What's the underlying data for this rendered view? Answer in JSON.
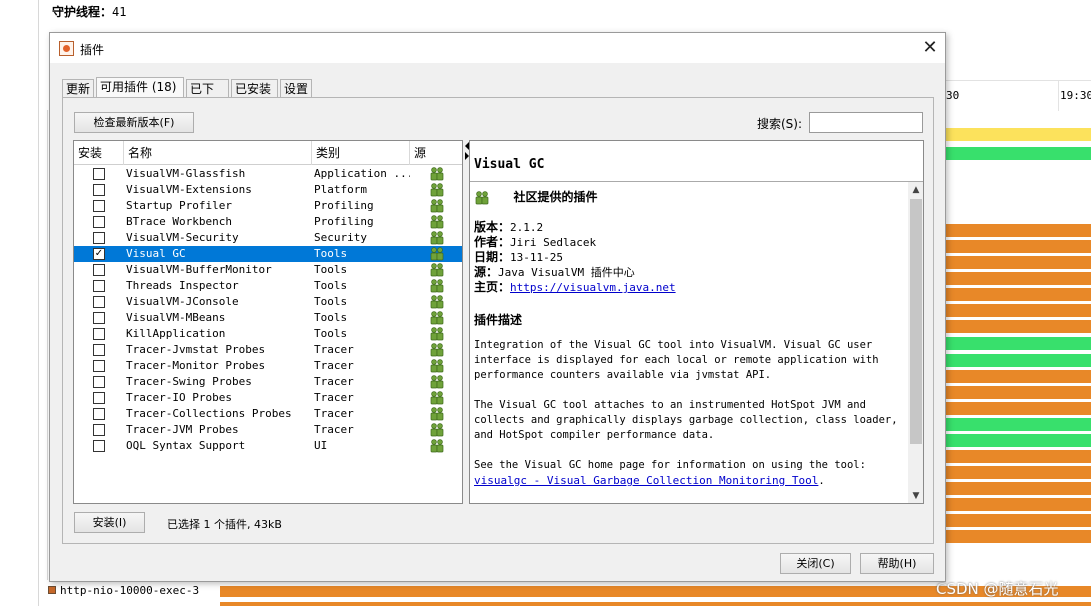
{
  "background": {
    "thread_label": "守护线程：",
    "thread_count": "41",
    "timeline_ticks": [
      "30",
      "19:30"
    ],
    "bottom_thread": "http-nio-10000-exec-3",
    "watermark": "CSDN @随意石光",
    "colors": {
      "yellow": "#fce25c",
      "green": "#38e06c",
      "orange": "#e88828"
    }
  },
  "dialog": {
    "title": "插件",
    "tabs": [
      {
        "label": "更新",
        "active": false
      },
      {
        "label": "可用插件 (18)",
        "active": true
      },
      {
        "label": "已下载",
        "active": false
      },
      {
        "label": "已安装",
        "active": false
      },
      {
        "label": "设置",
        "active": false
      }
    ],
    "check_updates_button": "检查最新版本(F)",
    "search_label": "搜索(S):",
    "search_value": "",
    "table": {
      "headers": [
        "安装",
        "名称",
        "类别",
        "源"
      ],
      "rows": [
        {
          "checked": false,
          "name": "VisualVM-Glassfish",
          "category": "Application ...",
          "selected": false
        },
        {
          "checked": false,
          "name": "VisualVM-Extensions",
          "category": "Platform",
          "selected": false
        },
        {
          "checked": false,
          "name": "Startup Profiler",
          "category": "Profiling",
          "selected": false
        },
        {
          "checked": false,
          "name": "BTrace Workbench",
          "category": "Profiling",
          "selected": false
        },
        {
          "checked": false,
          "name": "VisualVM-Security",
          "category": "Security",
          "selected": false
        },
        {
          "checked": true,
          "name": "Visual GC",
          "category": "Tools",
          "selected": true
        },
        {
          "checked": false,
          "name": "VisualVM-BufferMonitor",
          "category": "Tools",
          "selected": false
        },
        {
          "checked": false,
          "name": "Threads Inspector",
          "category": "Tools",
          "selected": false
        },
        {
          "checked": false,
          "name": "VisualVM-JConsole",
          "category": "Tools",
          "selected": false
        },
        {
          "checked": false,
          "name": "VisualVM-MBeans",
          "category": "Tools",
          "selected": false
        },
        {
          "checked": false,
          "name": "KillApplication",
          "category": "Tools",
          "selected": false
        },
        {
          "checked": false,
          "name": "Tracer-Jvmstat Probes",
          "category": "Tracer",
          "selected": false
        },
        {
          "checked": false,
          "name": "Tracer-Monitor Probes",
          "category": "Tracer",
          "selected": false
        },
        {
          "checked": false,
          "name": "Tracer-Swing Probes",
          "category": "Tracer",
          "selected": false
        },
        {
          "checked": false,
          "name": "Tracer-IO Probes",
          "category": "Tracer",
          "selected": false
        },
        {
          "checked": false,
          "name": "Tracer-Collections Probes",
          "category": "Tracer",
          "selected": false
        },
        {
          "checked": false,
          "name": "Tracer-JVM Probes",
          "category": "Tracer",
          "selected": false
        },
        {
          "checked": false,
          "name": "OQL Syntax Support",
          "category": "UI",
          "selected": false
        }
      ]
    },
    "detail": {
      "title": "Visual GC",
      "community_label": "社区提供的插件",
      "fields": [
        {
          "label": "版本：",
          "value": "2.1.2"
        },
        {
          "label": "作者：",
          "value": "Jiri Sedlacek"
        },
        {
          "label": "日期：",
          "value": "13-11-25"
        },
        {
          "label": "源：",
          "value": "Java VisualVM 插件中心"
        }
      ],
      "homepage_label": "主页：",
      "homepage_url": "https://visualvm.java.net",
      "description_heading": "插件描述",
      "paragraphs": [
        "Integration of the Visual GC tool into VisualVM. Visual GC user interface is displayed for each local or remote application with performance counters available via jvmstat API.",
        "The Visual GC tool attaches to an instrumented HotSpot JVM and collects and graphically displays garbage collection, class loader, and HotSpot compiler performance data."
      ],
      "home_text": "See the Visual GC home page for information on using the tool: ",
      "home_link": "visualgc - Visual Garbage Collection Monitoring Tool",
      "home_end": "."
    },
    "install_button": "安装(I)",
    "selected_info": "已选择 1 个插件, 43kB",
    "close_button": "关闭(C)",
    "help_button": "帮助(H)",
    "accent_color": "#0078d7",
    "icons": {
      "source": "community-people-icon",
      "title": "plugin-app-icon"
    }
  }
}
